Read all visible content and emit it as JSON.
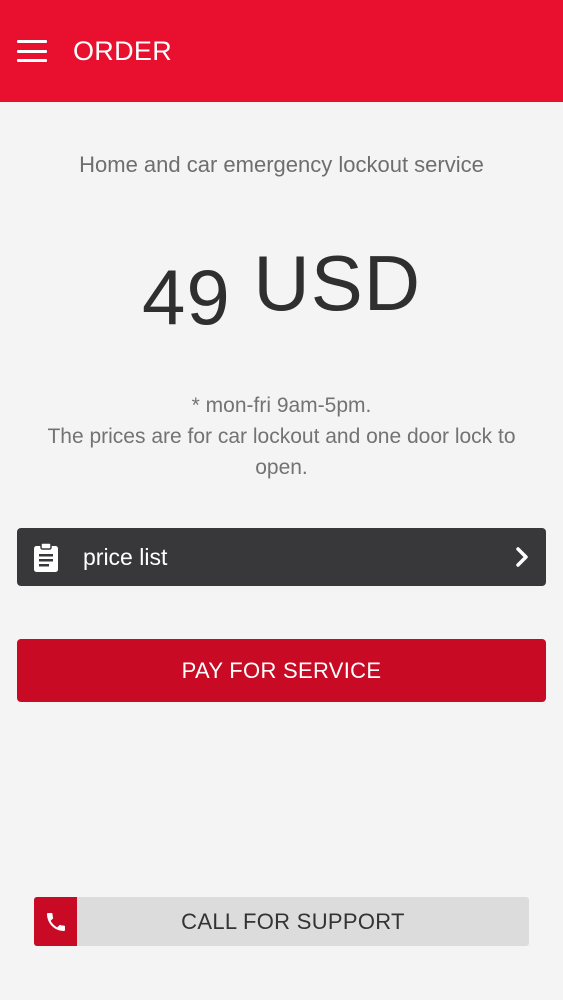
{
  "header": {
    "title": "ORDER",
    "menu_icon": "hamburger-menu-icon",
    "background_color": "#e8102e"
  },
  "service": {
    "description": "Home and car emergency lockout service",
    "price_amount": "49",
    "price_currency": "USD",
    "note_line1": "* mon-fri 9am-5pm.",
    "note_line2": "The prices are for car lockout and one door lock to open."
  },
  "price_list": {
    "label": "price list",
    "icon": "clipboard-icon",
    "chevron": "chevron-right-icon"
  },
  "pay_button": {
    "label": "PAY FOR SERVICE",
    "color": "#c80a24"
  },
  "support_button": {
    "label": "CALL FOR SUPPORT",
    "icon": "phone-icon"
  }
}
